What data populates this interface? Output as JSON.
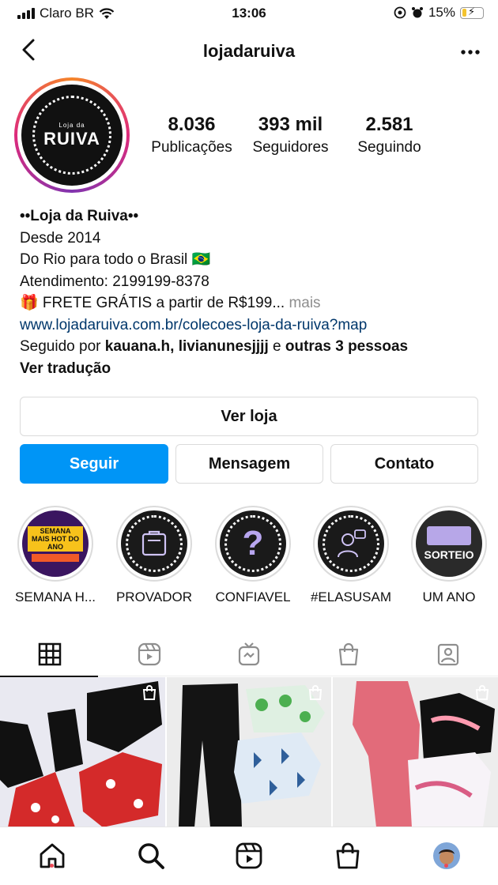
{
  "status_bar": {
    "carrier": "Claro BR",
    "time": "13:06",
    "battery": "15%"
  },
  "header": {
    "title": "lojadaruiva"
  },
  "avatar": {
    "small_text": "Loja da",
    "big_text": "RUIVA"
  },
  "stats": [
    {
      "num": "8.036",
      "label": "Publicações"
    },
    {
      "num": "393 mil",
      "label": "Seguidores"
    },
    {
      "num": "2.581",
      "label": "Seguindo"
    }
  ],
  "bio": {
    "name": "••Loja da Ruiva••",
    "line1": "Desde 2014",
    "line2": "Do Rio para todo o Brasil 🇧🇷",
    "line3": "Atendimento: 2199199-8378",
    "line4": "🎁 FRETE GRÁTIS a partir de R$199...",
    "more": "mais",
    "link": "www.lojadaruiva.com.br/colecoes-loja-da-ruiva?map",
    "followed_prefix": "Seguido por",
    "followed_user1": "kauana.h",
    "followed_comma": ",",
    "followed_user2": "livianunesjjjj",
    "followed_and": "e",
    "followed_others": "outras 3 pessoas",
    "translate": "Ver tradução"
  },
  "buttons": {
    "shop": "Ver loja",
    "follow": "Seguir",
    "message": "Mensagem",
    "contact": "Contato"
  },
  "highlights": [
    {
      "label": "SEMANA H...",
      "cover": "SEMANA MAIS HOT DO ANO"
    },
    {
      "label": "PROVADOR",
      "cover": ""
    },
    {
      "label": "CONFIAVEL",
      "cover": "?"
    },
    {
      "label": "#ELASUSAM",
      "cover": ""
    },
    {
      "label": "UM ANO",
      "cover": "SORTEIO"
    }
  ],
  "colors": {
    "accent": "#0095f6",
    "link": "#00376b",
    "notification": "#ed4956"
  }
}
